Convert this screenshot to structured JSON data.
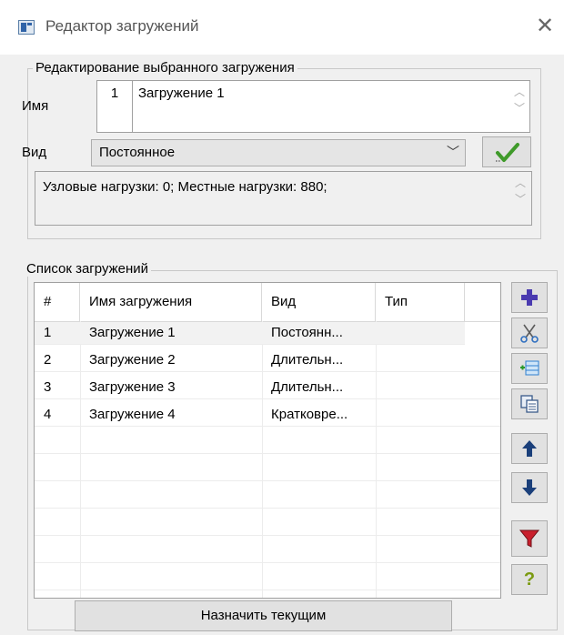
{
  "window": {
    "title": "Редактор загружений",
    "close_glyph": "✕"
  },
  "edit_group": {
    "legend": "Редактирование выбранного загружения",
    "name_label": "Имя",
    "name_number": "1",
    "name_value": "Загружение 1",
    "type_label": "Вид",
    "type_value": "Постоянное",
    "info_text": "Узловые нагрузки:  0;  Местные нагрузки:  880;"
  },
  "list_group": {
    "legend": "Список загружений",
    "columns": [
      "#",
      "Имя загружения",
      "Вид",
      "Тип"
    ],
    "rows": [
      {
        "num": "1",
        "name": "Загружение 1",
        "kind": "Постоянн...",
        "type": ""
      },
      {
        "num": "2",
        "name": "Загружение 2",
        "kind": "Длительн...",
        "type": ""
      },
      {
        "num": "3",
        "name": "Загружение 3",
        "kind": "Длительн...",
        "type": ""
      },
      {
        "num": "4",
        "name": "Загружение 4",
        "kind": "Кратковре...",
        "type": ""
      }
    ],
    "side_buttons": [
      "add-icon",
      "scissors-icon",
      "insert-table-icon",
      "copy-icon",
      "arrow-up-icon",
      "arrow-down-icon",
      "filter-icon",
      "help-icon"
    ],
    "assign_button": "Назначить текущим"
  },
  "colors": {
    "accent_blue": "#2f63a8",
    "check_green": "#3f9a2a",
    "add_purple": "#4b3bb0",
    "filter_red": "#c9202d",
    "help_green": "#7a9a10",
    "arrow_blue": "#1a3f7a"
  }
}
